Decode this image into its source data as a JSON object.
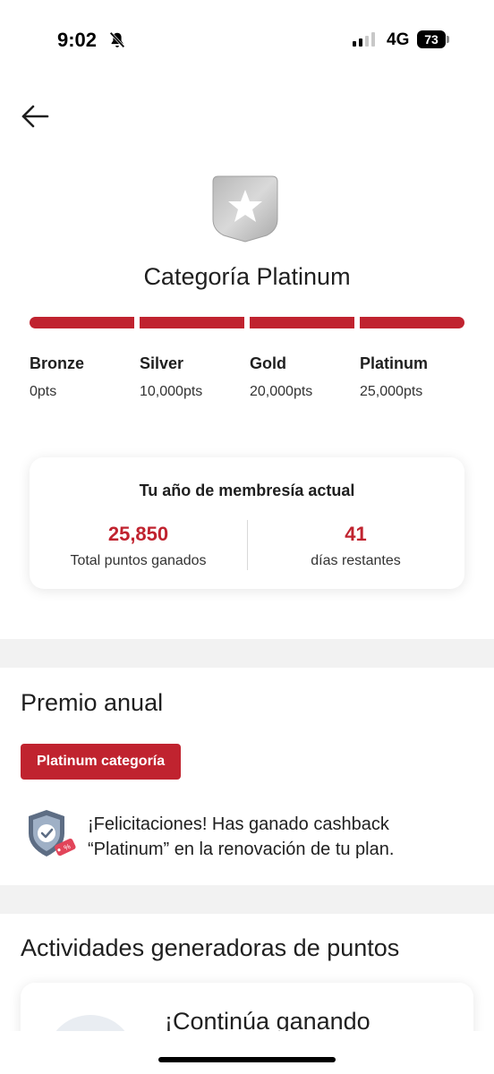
{
  "status_bar": {
    "time": "9:02",
    "network": "4G",
    "battery": "73",
    "icons": [
      "bell-slash-icon",
      "signal-icon",
      "battery-icon"
    ]
  },
  "header": {
    "back_icon": "arrow-left-icon"
  },
  "category": {
    "badge_icon": "star-shield-icon",
    "title": "Categoría Platinum",
    "progress_fraction": 1.0,
    "progress_color": "#c0232f",
    "tiers": [
      {
        "name": "Bronze",
        "points": "0pts"
      },
      {
        "name": "Silver",
        "points": "10,000pts"
      },
      {
        "name": "Gold",
        "points": "20,000pts"
      },
      {
        "name": "Platinum",
        "points": "25,000pts"
      }
    ]
  },
  "membership": {
    "title": "Tu año de membresía actual",
    "points_value": "25,850",
    "points_label": "Total puntos ganados",
    "days_value": "41",
    "days_label": "días restantes"
  },
  "annual_award": {
    "title": "Premio anual",
    "chip_label": "Platinum categoría",
    "icon": "shield-check-discount-icon",
    "message": "¡Felicitaciones! Has ganado cashback “Platinum” en la renovación de tu plan."
  },
  "activities": {
    "title": "Actividades generadoras de puntos",
    "card_title": "¡Continúa ganando"
  },
  "colors": {
    "accent": "#c0232f",
    "section_gap": "#f2f2f2"
  }
}
